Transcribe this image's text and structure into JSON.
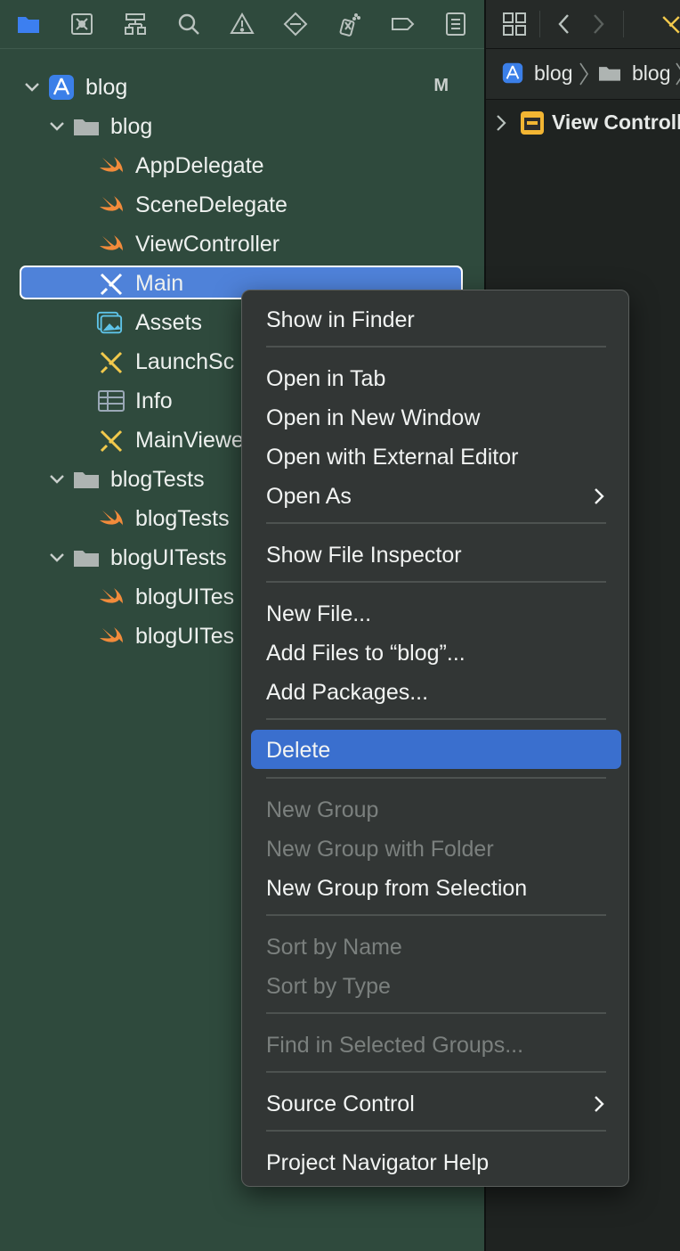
{
  "navigator": {
    "toolbar_icons": [
      "folder-icon",
      "source-control-icon",
      "hierarchy-icon",
      "search-icon",
      "warning-icon",
      "test-diamond-icon",
      "debug-spray-icon",
      "breakpoint-icon",
      "report-icon"
    ],
    "tree": [
      {
        "label": "blog",
        "icon": "xcode-project-icon",
        "badge": "M",
        "expanded": true
      },
      {
        "label": "blog",
        "icon": "folder-icon",
        "expanded": true
      },
      {
        "label": "AppDelegate",
        "icon": "swift-icon"
      },
      {
        "label": "SceneDelegate",
        "icon": "swift-icon"
      },
      {
        "label": "ViewController",
        "icon": "swift-icon"
      },
      {
        "label": "Main",
        "icon": "storyboard-icon",
        "selected": true
      },
      {
        "label": "Assets",
        "icon": "assets-icon"
      },
      {
        "label": "LaunchSc",
        "icon": "storyboard-icon"
      },
      {
        "label": "Info",
        "icon": "plist-icon"
      },
      {
        "label": "MainViewe",
        "icon": "storyboard-icon"
      },
      {
        "label": "blogTests",
        "icon": "folder-icon",
        "expanded": true
      },
      {
        "label": "blogTests",
        "icon": "swift-icon"
      },
      {
        "label": "blogUITests",
        "icon": "folder-icon",
        "expanded": true
      },
      {
        "label": "blogUITes",
        "icon": "swift-icon"
      },
      {
        "label": "blogUITes",
        "icon": "swift-icon"
      }
    ]
  },
  "editor": {
    "jumpbar": [
      "blog",
      "blog"
    ],
    "outline_item": "View Controll"
  },
  "context_menu": {
    "items": [
      {
        "label": "Show in Finder"
      },
      {
        "label": "Open in Tab"
      },
      {
        "label": "Open in New Window"
      },
      {
        "label": "Open with External Editor"
      },
      {
        "label": "Open As",
        "submenu": true
      },
      {
        "label": "Show File Inspector"
      },
      {
        "label": "New File..."
      },
      {
        "label": "Add Files to “blog”..."
      },
      {
        "label": "Add Packages..."
      },
      {
        "label": "Delete",
        "highlighted": true
      },
      {
        "label": "New Group",
        "disabled": true
      },
      {
        "label": "New Group with Folder",
        "disabled": true
      },
      {
        "label": "New Group from Selection"
      },
      {
        "label": "Sort by Name",
        "disabled": true
      },
      {
        "label": "Sort by Type",
        "disabled": true
      },
      {
        "label": "Find in Selected Groups...",
        "disabled": true
      },
      {
        "label": "Source Control",
        "submenu": true
      },
      {
        "label": "Project Navigator Help"
      }
    ]
  },
  "colors": {
    "navigator_bg": "#2f4a3d",
    "selection": "#4f82d9",
    "menu_highlight": "#3a6fce",
    "swift_orange": "#f28b3b",
    "accent_blue": "#3c7ff0"
  }
}
